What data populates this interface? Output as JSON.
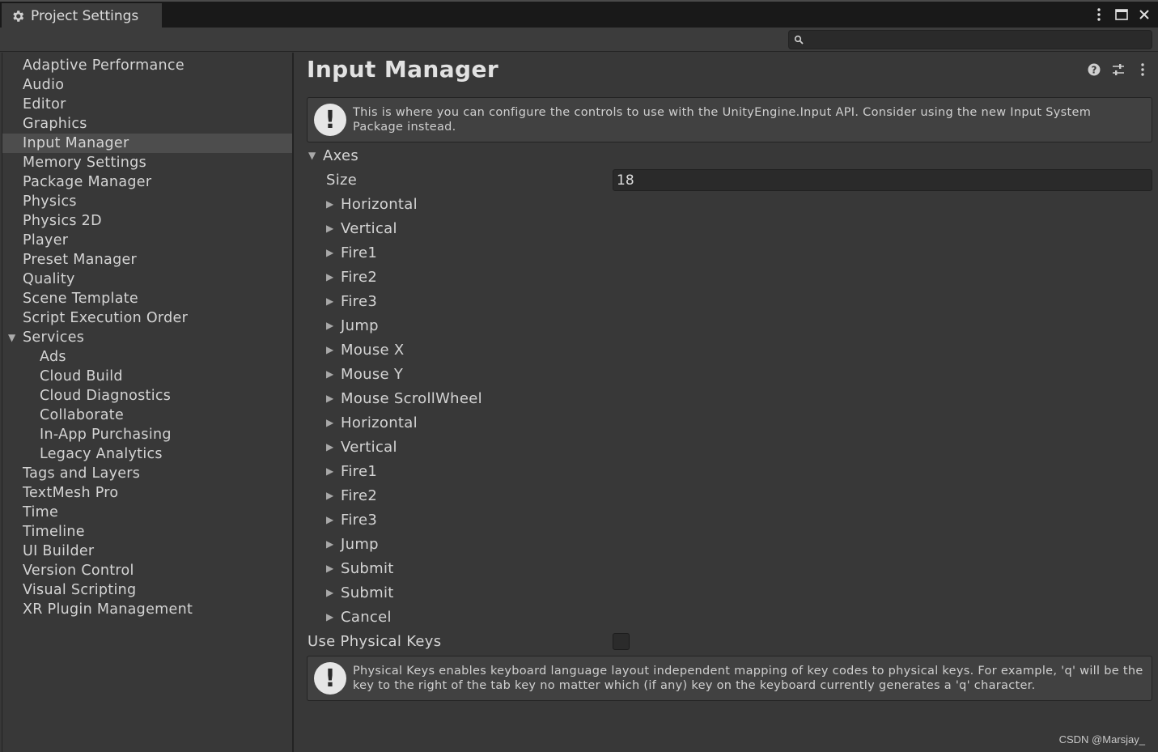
{
  "window": {
    "tab_title": "Project Settings",
    "tab_icon": "gear-icon",
    "controls": [
      "more-vertical-icon",
      "maximize-icon",
      "close-icon"
    ]
  },
  "search": {
    "placeholder": "",
    "value": ""
  },
  "sidebar": {
    "items": [
      {
        "label": "Adaptive Performance",
        "level": 0
      },
      {
        "label": "Audio",
        "level": 0
      },
      {
        "label": "Editor",
        "level": 0
      },
      {
        "label": "Graphics",
        "level": 0
      },
      {
        "label": "Input Manager",
        "level": 0,
        "selected": true
      },
      {
        "label": "Memory Settings",
        "level": 0
      },
      {
        "label": "Package Manager",
        "level": 0
      },
      {
        "label": "Physics",
        "level": 0
      },
      {
        "label": "Physics 2D",
        "level": 0
      },
      {
        "label": "Player",
        "level": 0
      },
      {
        "label": "Preset Manager",
        "level": 0
      },
      {
        "label": "Quality",
        "level": 0
      },
      {
        "label": "Scene Template",
        "level": 0
      },
      {
        "label": "Script Execution Order",
        "level": 0
      },
      {
        "label": "Services",
        "level": 0,
        "expanded": true
      },
      {
        "label": "Ads",
        "level": 1
      },
      {
        "label": "Cloud Build",
        "level": 1
      },
      {
        "label": "Cloud Diagnostics",
        "level": 1
      },
      {
        "label": "Collaborate",
        "level": 1
      },
      {
        "label": "In-App Purchasing",
        "level": 1
      },
      {
        "label": "Legacy Analytics",
        "level": 1
      },
      {
        "label": "Tags and Layers",
        "level": 0
      },
      {
        "label": "TextMesh Pro",
        "level": 0
      },
      {
        "label": "Time",
        "level": 0
      },
      {
        "label": "Timeline",
        "level": 0
      },
      {
        "label": "UI Builder",
        "level": 0
      },
      {
        "label": "Version Control",
        "level": 0
      },
      {
        "label": "Visual Scripting",
        "level": 0
      },
      {
        "label": "XR Plugin Management",
        "level": 0
      }
    ]
  },
  "main": {
    "title": "Input Manager",
    "header_icons": [
      "help-icon",
      "preset-sliders-icon",
      "more-vertical-icon"
    ],
    "info_text": "This is where you can configure the controls to use with the UnityEngine.Input API. Consider using the new Input System Package instead.",
    "axes_label": "Axes",
    "size_label": "Size",
    "size_value": "18",
    "axes": [
      "Horizontal",
      "Vertical",
      "Fire1",
      "Fire2",
      "Fire3",
      "Jump",
      "Mouse X",
      "Mouse Y",
      "Mouse ScrollWheel",
      "Horizontal",
      "Vertical",
      "Fire1",
      "Fire2",
      "Fire3",
      "Jump",
      "Submit",
      "Submit",
      "Cancel"
    ],
    "physical_keys_label": "Use Physical Keys",
    "physical_keys_checked": false,
    "physical_keys_info": "Physical Keys enables keyboard language layout independent mapping of key codes to physical keys. For example, 'q' will be the key to the right of the tab key no matter which (if any) key on the keyboard currently generates a 'q' character."
  },
  "watermark": "CSDN @Marsjay_"
}
